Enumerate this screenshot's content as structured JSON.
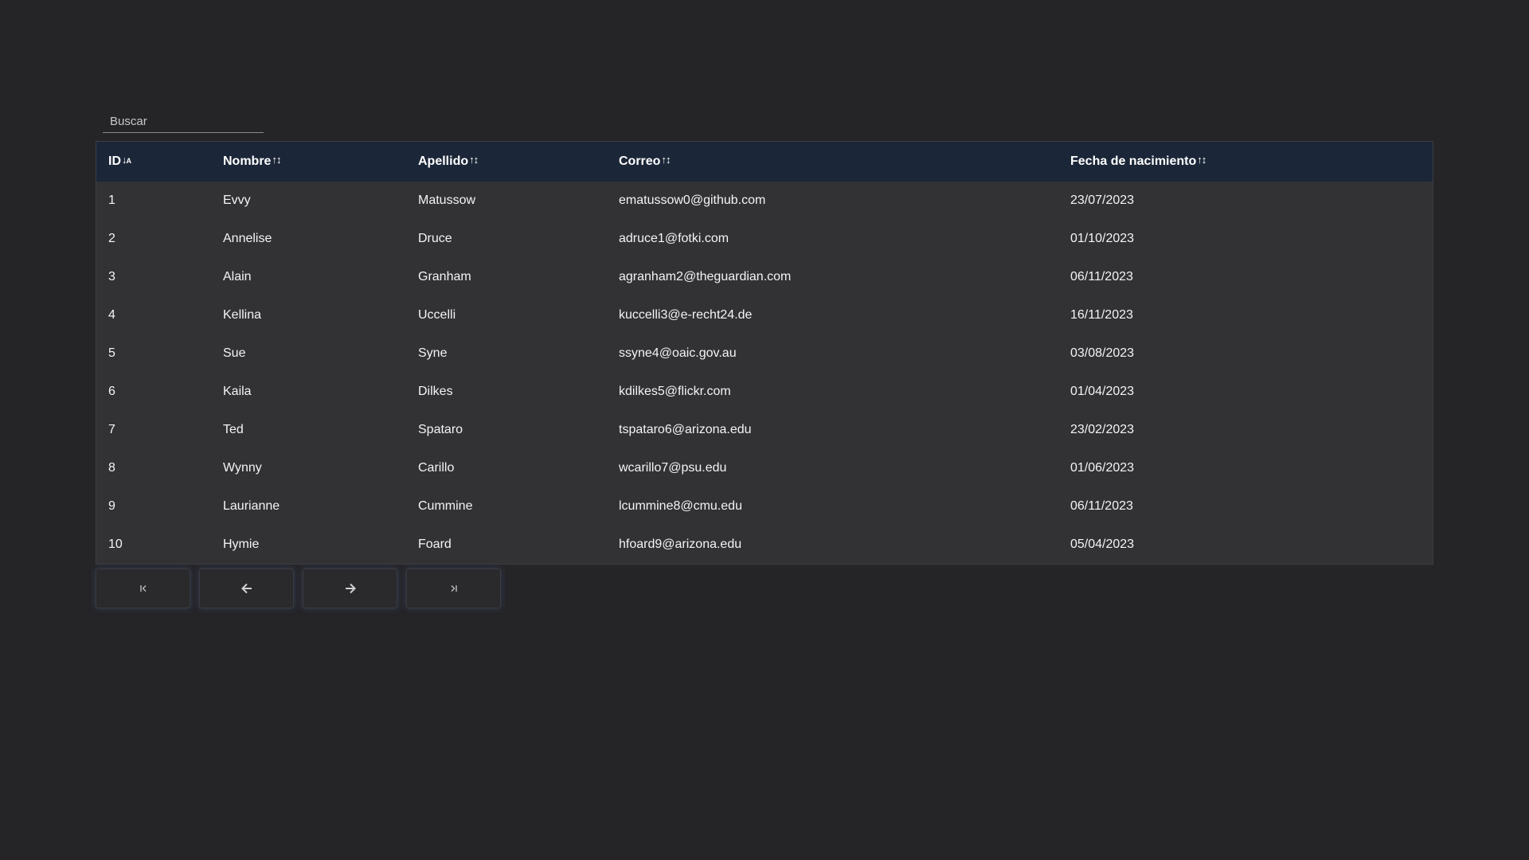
{
  "search": {
    "placeholder": "Buscar",
    "value": ""
  },
  "table": {
    "columns": [
      {
        "label": "ID",
        "sort": "desc"
      },
      {
        "label": "Nombre",
        "sort": "none"
      },
      {
        "label": "Apellido",
        "sort": "none"
      },
      {
        "label": "Correo",
        "sort": "none"
      },
      {
        "label": "Fecha de nacimiento",
        "sort": "none"
      }
    ],
    "rows": [
      [
        "1",
        "Evvy",
        "Matussow",
        "ematussow0@github.com",
        "23/07/2023"
      ],
      [
        "2",
        "Annelise",
        "Druce",
        "adruce1@fotki.com",
        "01/10/2023"
      ],
      [
        "3",
        "Alain",
        "Granham",
        "agranham2@theguardian.com",
        "06/11/2023"
      ],
      [
        "4",
        "Kellina",
        "Uccelli",
        "kuccelli3@e-recht24.de",
        "16/11/2023"
      ],
      [
        "5",
        "Sue",
        "Syne",
        "ssyne4@oaic.gov.au",
        "03/08/2023"
      ],
      [
        "6",
        "Kaila",
        "Dilkes",
        "kdilkes5@flickr.com",
        "01/04/2023"
      ],
      [
        "7",
        "Ted",
        "Spataro",
        "tspataro6@arizona.edu",
        "23/02/2023"
      ],
      [
        "8",
        "Wynny",
        "Carillo",
        "wcarillo7@psu.edu",
        "01/06/2023"
      ],
      [
        "9",
        "Laurianne",
        "Cummine",
        "lcummine8@cmu.edu",
        "06/11/2023"
      ],
      [
        "10",
        "Hymie",
        "Foard",
        "hfoard9@arizona.edu",
        "05/04/2023"
      ]
    ]
  },
  "pagination": {
    "buttons": [
      {
        "name": "first-page-button",
        "icon": "first-page-icon"
      },
      {
        "name": "previous-page-button",
        "icon": "arrow-left-icon"
      },
      {
        "name": "next-page-button",
        "icon": "arrow-right-icon"
      },
      {
        "name": "last-page-button",
        "icon": "last-page-icon"
      }
    ]
  },
  "colors": {
    "background": "#252528",
    "table_body": "#323235",
    "table_header": "#1b2638",
    "text": "#ffffff"
  }
}
